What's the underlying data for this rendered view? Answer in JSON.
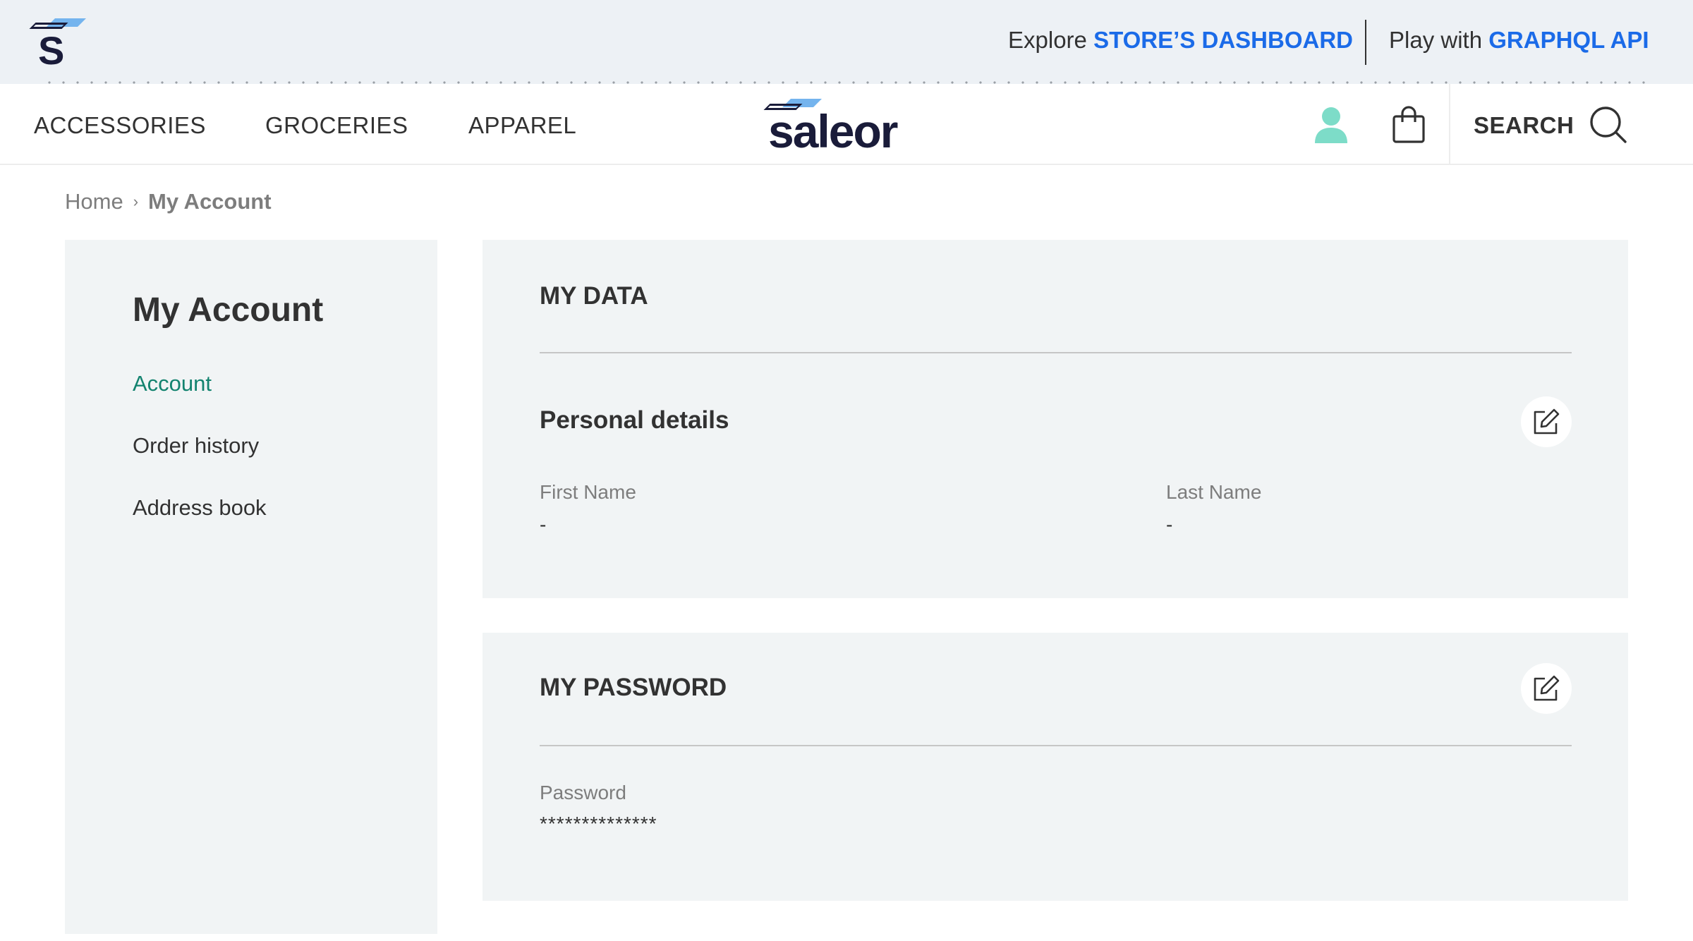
{
  "topbar": {
    "logo_letter": "S",
    "promo1_prefix": "Explore",
    "promo1_link": "STORE’S DASHBOARD",
    "promo2_prefix": "Play with",
    "promo2_link": "GRAPHQL API"
  },
  "nav": {
    "items": [
      {
        "label": "ACCESSORIES"
      },
      {
        "label": "GROCERIES"
      },
      {
        "label": "APPAREL"
      }
    ],
    "brand": "saleor",
    "search_label": "SEARCH",
    "icons": {
      "user": "user-icon",
      "cart": "shopping-bag-icon",
      "search": "search-icon"
    },
    "user_icon_color": "#7ddcc8"
  },
  "breadcrumb": {
    "home": "Home",
    "separator": "›",
    "current": "My Account"
  },
  "sidebar": {
    "title": "My Account",
    "links": [
      {
        "label": "Account",
        "active": true
      },
      {
        "label": "Order history",
        "active": false
      },
      {
        "label": "Address book",
        "active": false
      }
    ],
    "active_color": "#13836f"
  },
  "my_data": {
    "heading": "MY DATA",
    "personal_details": "Personal details",
    "first_name_label": "First Name",
    "first_name_value": "-",
    "last_name_label": "Last Name",
    "last_name_value": "-"
  },
  "my_password": {
    "heading": "MY PASSWORD",
    "password_label": "Password",
    "password_value": "**************"
  },
  "colors": {
    "link_blue": "#1b6be8",
    "panel_bg": "#f1f4f5",
    "topbar_bg": "#edf1f5",
    "brand_navy": "#1a1c3a"
  }
}
